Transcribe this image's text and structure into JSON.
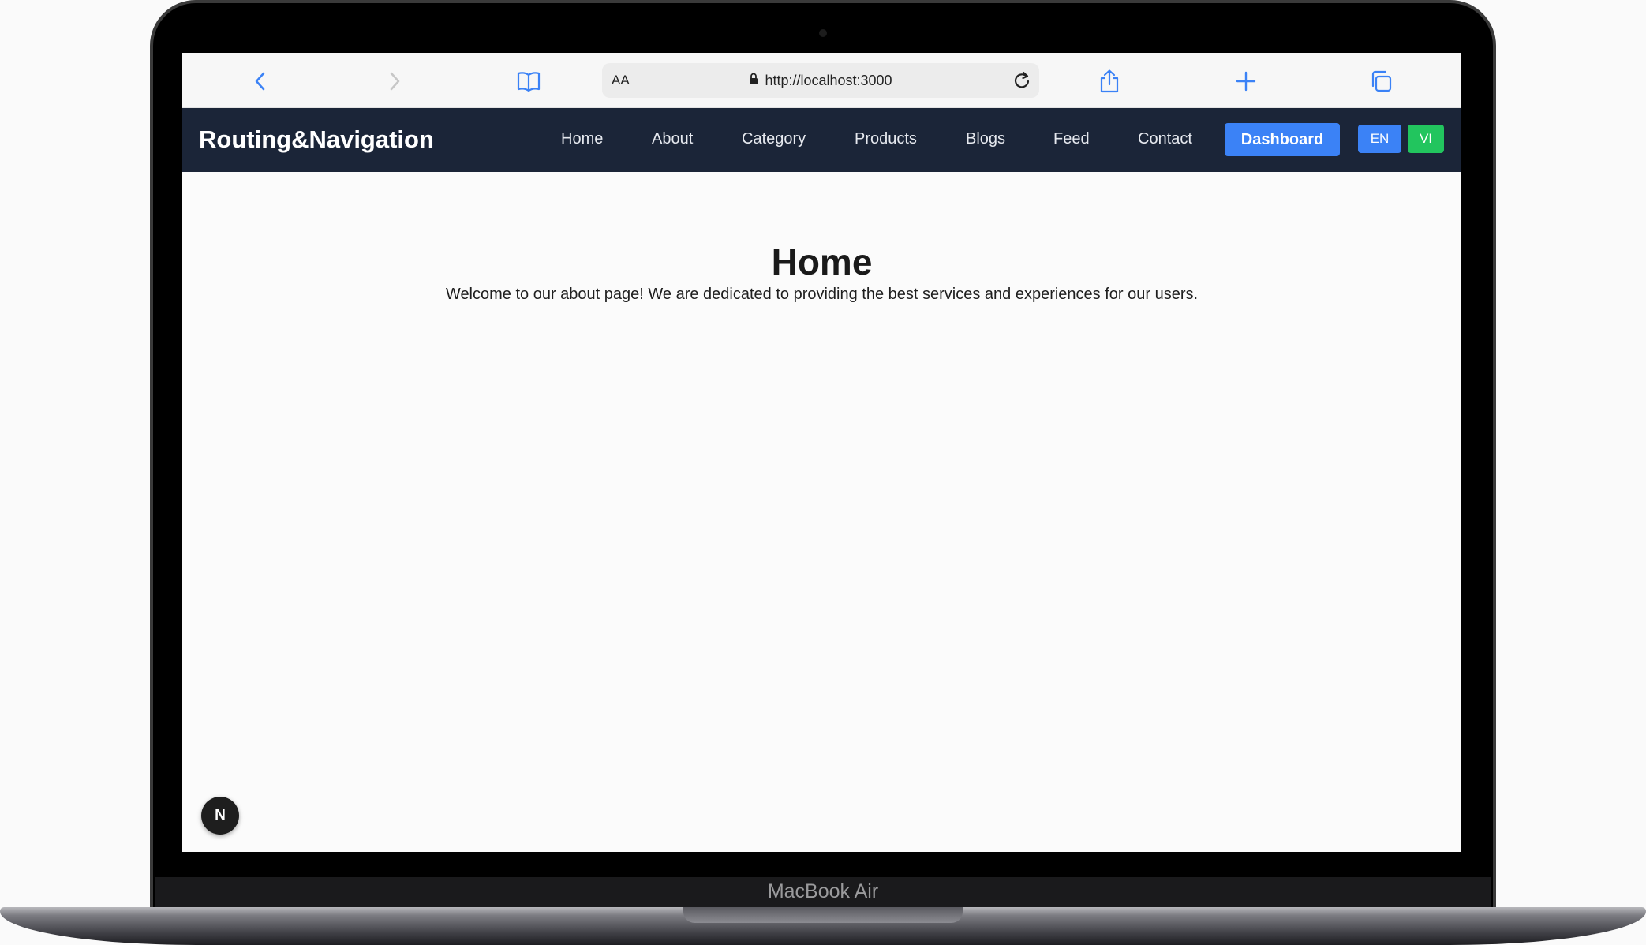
{
  "device": {
    "model_label": "MacBook Air"
  },
  "browser": {
    "text_size_label": "AA",
    "url": "http://localhost:3000",
    "icons": {
      "back": "chevron-left-icon",
      "forward": "chevron-right-icon",
      "bookmarks": "book-icon",
      "lock": "lock-icon",
      "reload": "reload-icon",
      "share": "share-icon",
      "new_tab": "plus-icon",
      "tabs": "tabs-icon"
    }
  },
  "navbar": {
    "brand": "Routing&Navigation",
    "links": [
      "Home",
      "About",
      "Category",
      "Products",
      "Blogs",
      "Feed",
      "Contact"
    ],
    "dashboard_label": "Dashboard",
    "lang_en": "EN",
    "lang_vi": "VI",
    "colors": {
      "background": "#1b2538",
      "dashboard": "#3b82f6",
      "en": "#3b82f6",
      "vi": "#22c55e"
    }
  },
  "main": {
    "title": "Home",
    "description": "Welcome to our about page! We are dedicated to providing the best services and experiences for our users."
  },
  "dev_badge": {
    "label": "N",
    "icon": "nextjs-icon"
  }
}
